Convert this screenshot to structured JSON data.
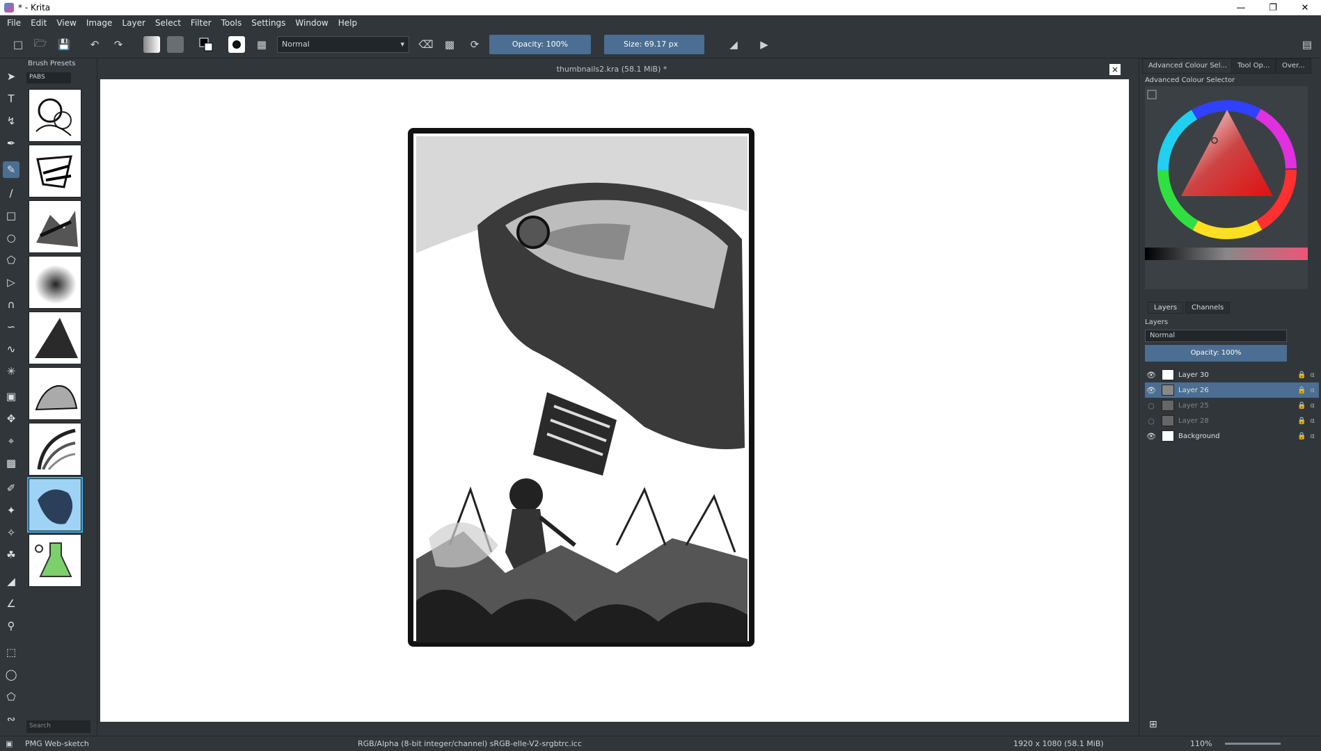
{
  "window": {
    "title": "* - Krita"
  },
  "menu": [
    "File",
    "Edit",
    "View",
    "Image",
    "Layer",
    "Select",
    "Filter",
    "Tools",
    "Settings",
    "Window",
    "Help"
  ],
  "toolbar": {
    "blend_mode": "Normal",
    "opacity_label": "Opacity:  100%",
    "size_label": "Size:  69.17 px"
  },
  "brush_presets": {
    "title": "Brush Presets",
    "tag": "PABS",
    "search_placeholder": "Search",
    "selected_index": 7
  },
  "document": {
    "tab_title": "thumbnails2.kra (58.1 MiB) *"
  },
  "right_dock": {
    "tabs": [
      "Advanced Colour Sel...",
      "Tool Op...",
      "Over..."
    ],
    "color_selector_label": "Advanced Colour Selector",
    "layer_tabs": [
      "Layers",
      "Channels"
    ],
    "layers_label": "Layers",
    "layer_blend": "Normal",
    "layer_opacity": "Opacity:  100%",
    "layers": [
      {
        "name": "Layer 30",
        "visible": true,
        "active": false
      },
      {
        "name": "Layer 26",
        "visible": true,
        "active": true
      },
      {
        "name": "Layer 25",
        "visible": false,
        "active": false
      },
      {
        "name": "Layer 28",
        "visible": false,
        "active": false
      },
      {
        "name": "Background",
        "visible": true,
        "active": false
      }
    ]
  },
  "status": {
    "brush": "PMG Web-sketch",
    "color_space": "RGB/Alpha (8-bit integer/channel)  sRGB-elle-V2-srgbtrc.icc",
    "image_size": "1920 x 1080 (58.1 MiB)",
    "zoom": "110%"
  },
  "colors": {
    "ui_bg": "#31363b",
    "accent": "#4b6e92",
    "highlight": "#3daee9"
  }
}
